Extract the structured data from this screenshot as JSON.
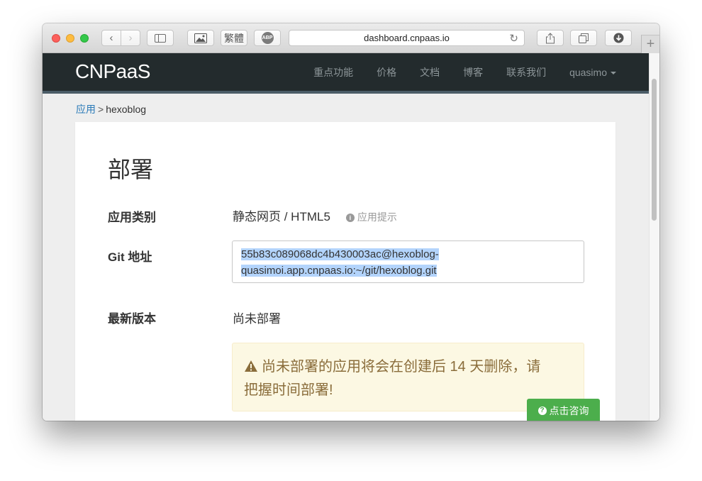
{
  "browser": {
    "url": "dashboard.cnpaas.io",
    "trad_label": "繁體",
    "abp_label": "ABP"
  },
  "navbar": {
    "brand": "CNPaaS",
    "links": [
      "重点功能",
      "价格",
      "文档",
      "博客",
      "联系我们"
    ],
    "user": "quasimo"
  },
  "breadcrumb": {
    "parent": "应用",
    "separator": ">",
    "current": "hexoblog"
  },
  "deploy": {
    "title": "部署",
    "app_type_label": "应用类别",
    "app_type_value": "静态网页 / HTML5",
    "app_hint": "应用提示",
    "git_label": "Git 地址",
    "git_line1": "55b83c089068dc4b430003ac@hexoblog-",
    "git_line2": "quasimoi.app.cnpaas.io:~/git/hexoblog.git",
    "latest_label": "最新版本",
    "latest_value": "尚未部署",
    "alert_line1": "尚未部署的应用将会在创建后 14 天删除，请",
    "alert_line2": "把握时间部署!"
  },
  "consult_button": "点击咨询",
  "colors": {
    "navbar": "#232b2d",
    "link": "#2a7ab8",
    "alert_bg": "#fcf8e3",
    "alert_text": "#8a6d3b",
    "consult_bg": "#4cae4c",
    "selection": "#b3d4fc"
  }
}
